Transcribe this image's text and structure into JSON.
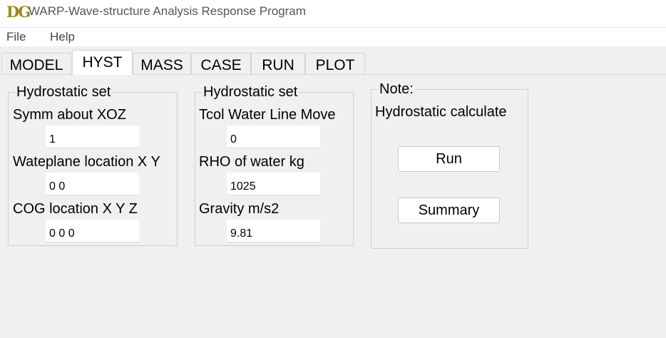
{
  "window": {
    "logo": "DG",
    "title": "WARP-Wave-structure Analysis Response Program"
  },
  "menu": [
    "File",
    "Help"
  ],
  "tabs": [
    "MODEL",
    "HYST",
    "MASS",
    "CASE",
    "RUN",
    "PLOT"
  ],
  "active_tab": "HYST",
  "group1": {
    "title": "Hydrostatic set",
    "fields": [
      {
        "label": "Symm about XOZ",
        "value": "1"
      },
      {
        "label": "Wateplane location X Y",
        "value": "0 0"
      },
      {
        "label": "COG location X Y Z",
        "value": "0 0 0"
      }
    ]
  },
  "group2": {
    "title": "Hydrostatic set",
    "fields": [
      {
        "label": "Tcol Water Line Move",
        "value": "0"
      },
      {
        "label": "RHO of water kg",
        "value": "1025"
      },
      {
        "label": "Gravity  m/s2",
        "value": "9.81"
      }
    ]
  },
  "note": {
    "title": "Note:",
    "text": "Hydrostatic calculate",
    "run_label": "Run",
    "summary_label": "Summary"
  }
}
